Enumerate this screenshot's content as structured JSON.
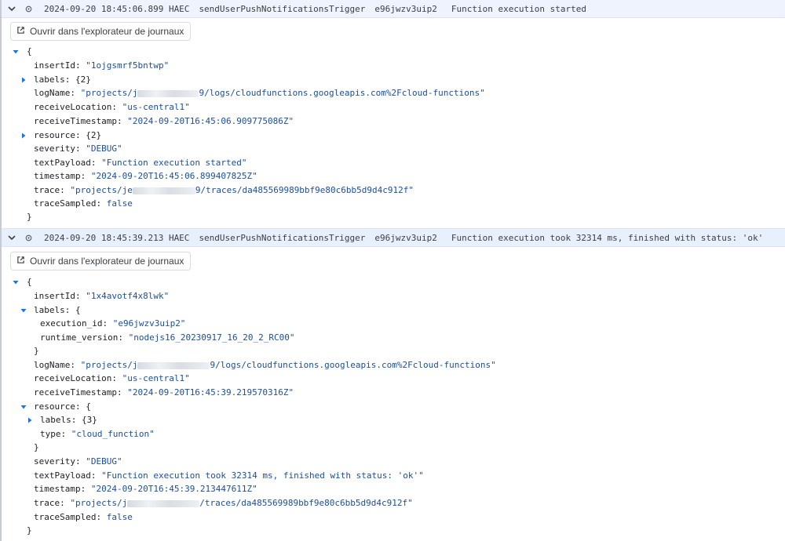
{
  "entries": [
    {
      "header": {
        "timestamp": "2024-09-20 18:45:06.899 HAEC",
        "function": "sendUserPushNotificationsTrigger",
        "execution_id": "e96jwzv3uip2",
        "message": "Function execution started"
      },
      "open_button": "Ouvrir dans l'explorateur de journaux",
      "json": {
        "open_brace": "{",
        "close_brace": "}",
        "insertId_key": "insertId:",
        "insertId_val": "\"1ojgsmrf5bntwp\"",
        "labels_key": "labels:",
        "labels_val": "{2}",
        "logName_key": "logName:",
        "logName_pre": "\"projects/j",
        "logName_post": "9/logs/cloudfunctions.googleapis.com%2Fcloud-functions\"",
        "receiveLocation_key": "receiveLocation:",
        "receiveLocation_val": "\"us-central1\"",
        "receiveTimestamp_key": "receiveTimestamp:",
        "receiveTimestamp_val": "\"2024-09-20T16:45:06.909775086Z\"",
        "resource_key": "resource:",
        "resource_val": "{2}",
        "severity_key": "severity:",
        "severity_val": "\"DEBUG\"",
        "textPayload_key": "textPayload:",
        "textPayload_val": "\"Function execution started\"",
        "timestamp_key": "timestamp:",
        "timestamp_val": "\"2024-09-20T16:45:06.899407825Z\"",
        "trace_key": "trace:",
        "trace_pre": "\"projects/je",
        "trace_post": "9/traces/da485569989bbf9e80c6bb5d9d4c912f\"",
        "traceSampled_key": "traceSampled:",
        "traceSampled_val": "false"
      }
    },
    {
      "header": {
        "timestamp": "2024-09-20 18:45:39.213 HAEC",
        "function": "sendUserPushNotificationsTrigger",
        "execution_id": "e96jwzv3uip2",
        "message": "Function execution took 32314 ms, finished with status: 'ok'"
      },
      "open_button": "Ouvrir dans l'explorateur de journaux",
      "json": {
        "open_brace": "{",
        "close_brace": "}",
        "insertId_key": "insertId:",
        "insertId_val": "\"1x4avotf4x8lwk\"",
        "labels_key": "labels:",
        "labels_open": "{",
        "labels_close": "}",
        "execution_id_key": "execution_id:",
        "execution_id_val": "\"e96jwzv3uip2\"",
        "runtime_version_key": "runtime_version:",
        "runtime_version_val": "\"nodejs16_20230917_16_20_2_RC00\"",
        "logName_key": "logName:",
        "logName_pre": "\"projects/j",
        "logName_post": "9/logs/cloudfunctions.googleapis.com%2Fcloud-functions\"",
        "receiveLocation_key": "receiveLocation:",
        "receiveLocation_val": "\"us-central1\"",
        "receiveTimestamp_key": "receiveTimestamp:",
        "receiveTimestamp_val": "\"2024-09-20T16:45:39.219570316Z\"",
        "resource_key": "resource:",
        "resource_open": "{",
        "resource_close": "}",
        "res_labels_key": "labels:",
        "res_labels_val": "{3}",
        "type_key": "type:",
        "type_val": "\"cloud_function\"",
        "severity_key": "severity:",
        "severity_val": "\"DEBUG\"",
        "textPayload_key": "textPayload:",
        "textPayload_val": "\"Function execution took 32314 ms, finished with status: 'ok'\"",
        "timestamp_key": "timestamp:",
        "timestamp_val": "\"2024-09-20T16:45:39.213447611Z\"",
        "trace_key": "trace:",
        "trace_pre": "\"projects/j",
        "trace_post": "/traces/da485569989bbf9e80c6bb5d9d4c912f\"",
        "traceSampled_key": "traceSampled:",
        "traceSampled_val": "false"
      }
    }
  ],
  "icons": {
    "collapse": "chevron-down-icon",
    "severity": "debug-severity-icon",
    "open_external": "open-in-new-icon",
    "expand": "triangle-right-icon",
    "collapse_tree": "triangle-down-icon"
  },
  "colors": {
    "header_bg": "#e8f0fe",
    "string_value": "#1a4fa3",
    "tree_toggle": "#1a73e8"
  }
}
